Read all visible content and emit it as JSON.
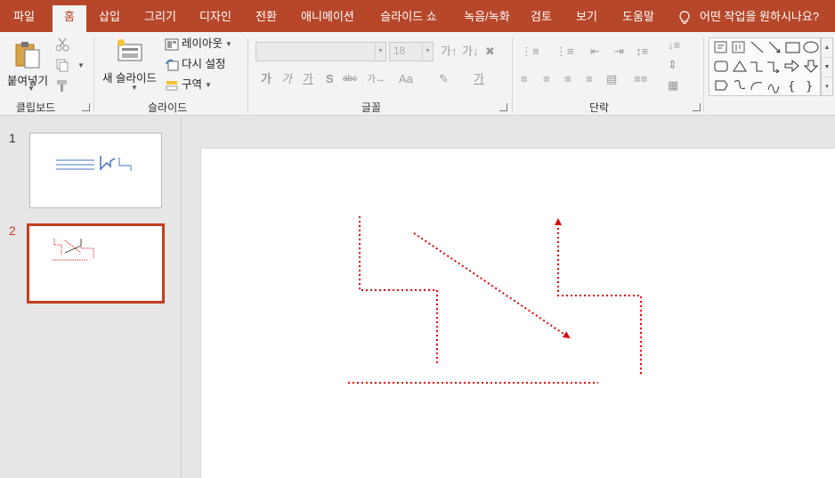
{
  "tabs": [
    {
      "label": "파일",
      "active": false
    },
    {
      "label": "홈",
      "active": true
    },
    {
      "label": "삽입",
      "active": false
    },
    {
      "label": "그리기",
      "active": false
    },
    {
      "label": "디자인",
      "active": false
    },
    {
      "label": "전환",
      "active": false
    },
    {
      "label": "애니메이션",
      "active": false
    },
    {
      "label": "슬라이드 쇼",
      "active": false
    },
    {
      "label": "녹음/녹화",
      "active": false
    },
    {
      "label": "검토",
      "active": false
    },
    {
      "label": "보기",
      "active": false
    },
    {
      "label": "도움말",
      "active": false
    }
  ],
  "tell_me": "어떤 작업을 원하시나요?",
  "clipboard": {
    "paste_label": "붙여넣기",
    "group_label": "클립보드"
  },
  "slides_group": {
    "new_slide_label": "새 슬라이드",
    "layout_label": "레이아웃",
    "reset_label": "다시 설정",
    "section_label": "구역",
    "group_label": "슬라이드"
  },
  "font_group": {
    "font_size": "18",
    "group_label": "글꼴"
  },
  "paragraph_group": {
    "group_label": "단락"
  },
  "slides": [
    {
      "number": "1",
      "selected": false
    },
    {
      "number": "2",
      "selected": true
    }
  ],
  "colors": {
    "accent": "#b7472a",
    "selection": "#c43e1c",
    "shape_red": "#e00000",
    "shape_blue": "#4472c4"
  }
}
